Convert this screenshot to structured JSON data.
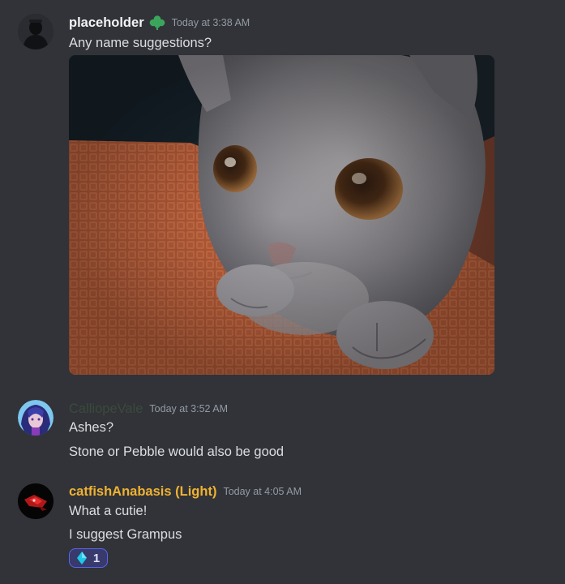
{
  "messages": [
    {
      "username": "placeholder",
      "username_color": "#f2f3f5",
      "badge_icon": "clover-icon",
      "timestamp": "Today at 3:38 AM",
      "lines": [
        "Any name suggestions?"
      ],
      "attachment": "kitten-photo"
    },
    {
      "username": "CalliopeVale",
      "username_color": "#3b4a3a",
      "timestamp": "Today at 3:52 AM",
      "lines": [
        "Ashes?",
        "Stone or Pebble would also be good"
      ]
    },
    {
      "username": "catfishAnabasis (Light)",
      "username_color": "#f0b232",
      "timestamp": "Today at 4:05 AM",
      "lines": [
        "What a cutie!",
        "I suggest Grampus"
      ],
      "reaction": {
        "icon": "blue-diamond-icon",
        "count": "1"
      }
    }
  ]
}
